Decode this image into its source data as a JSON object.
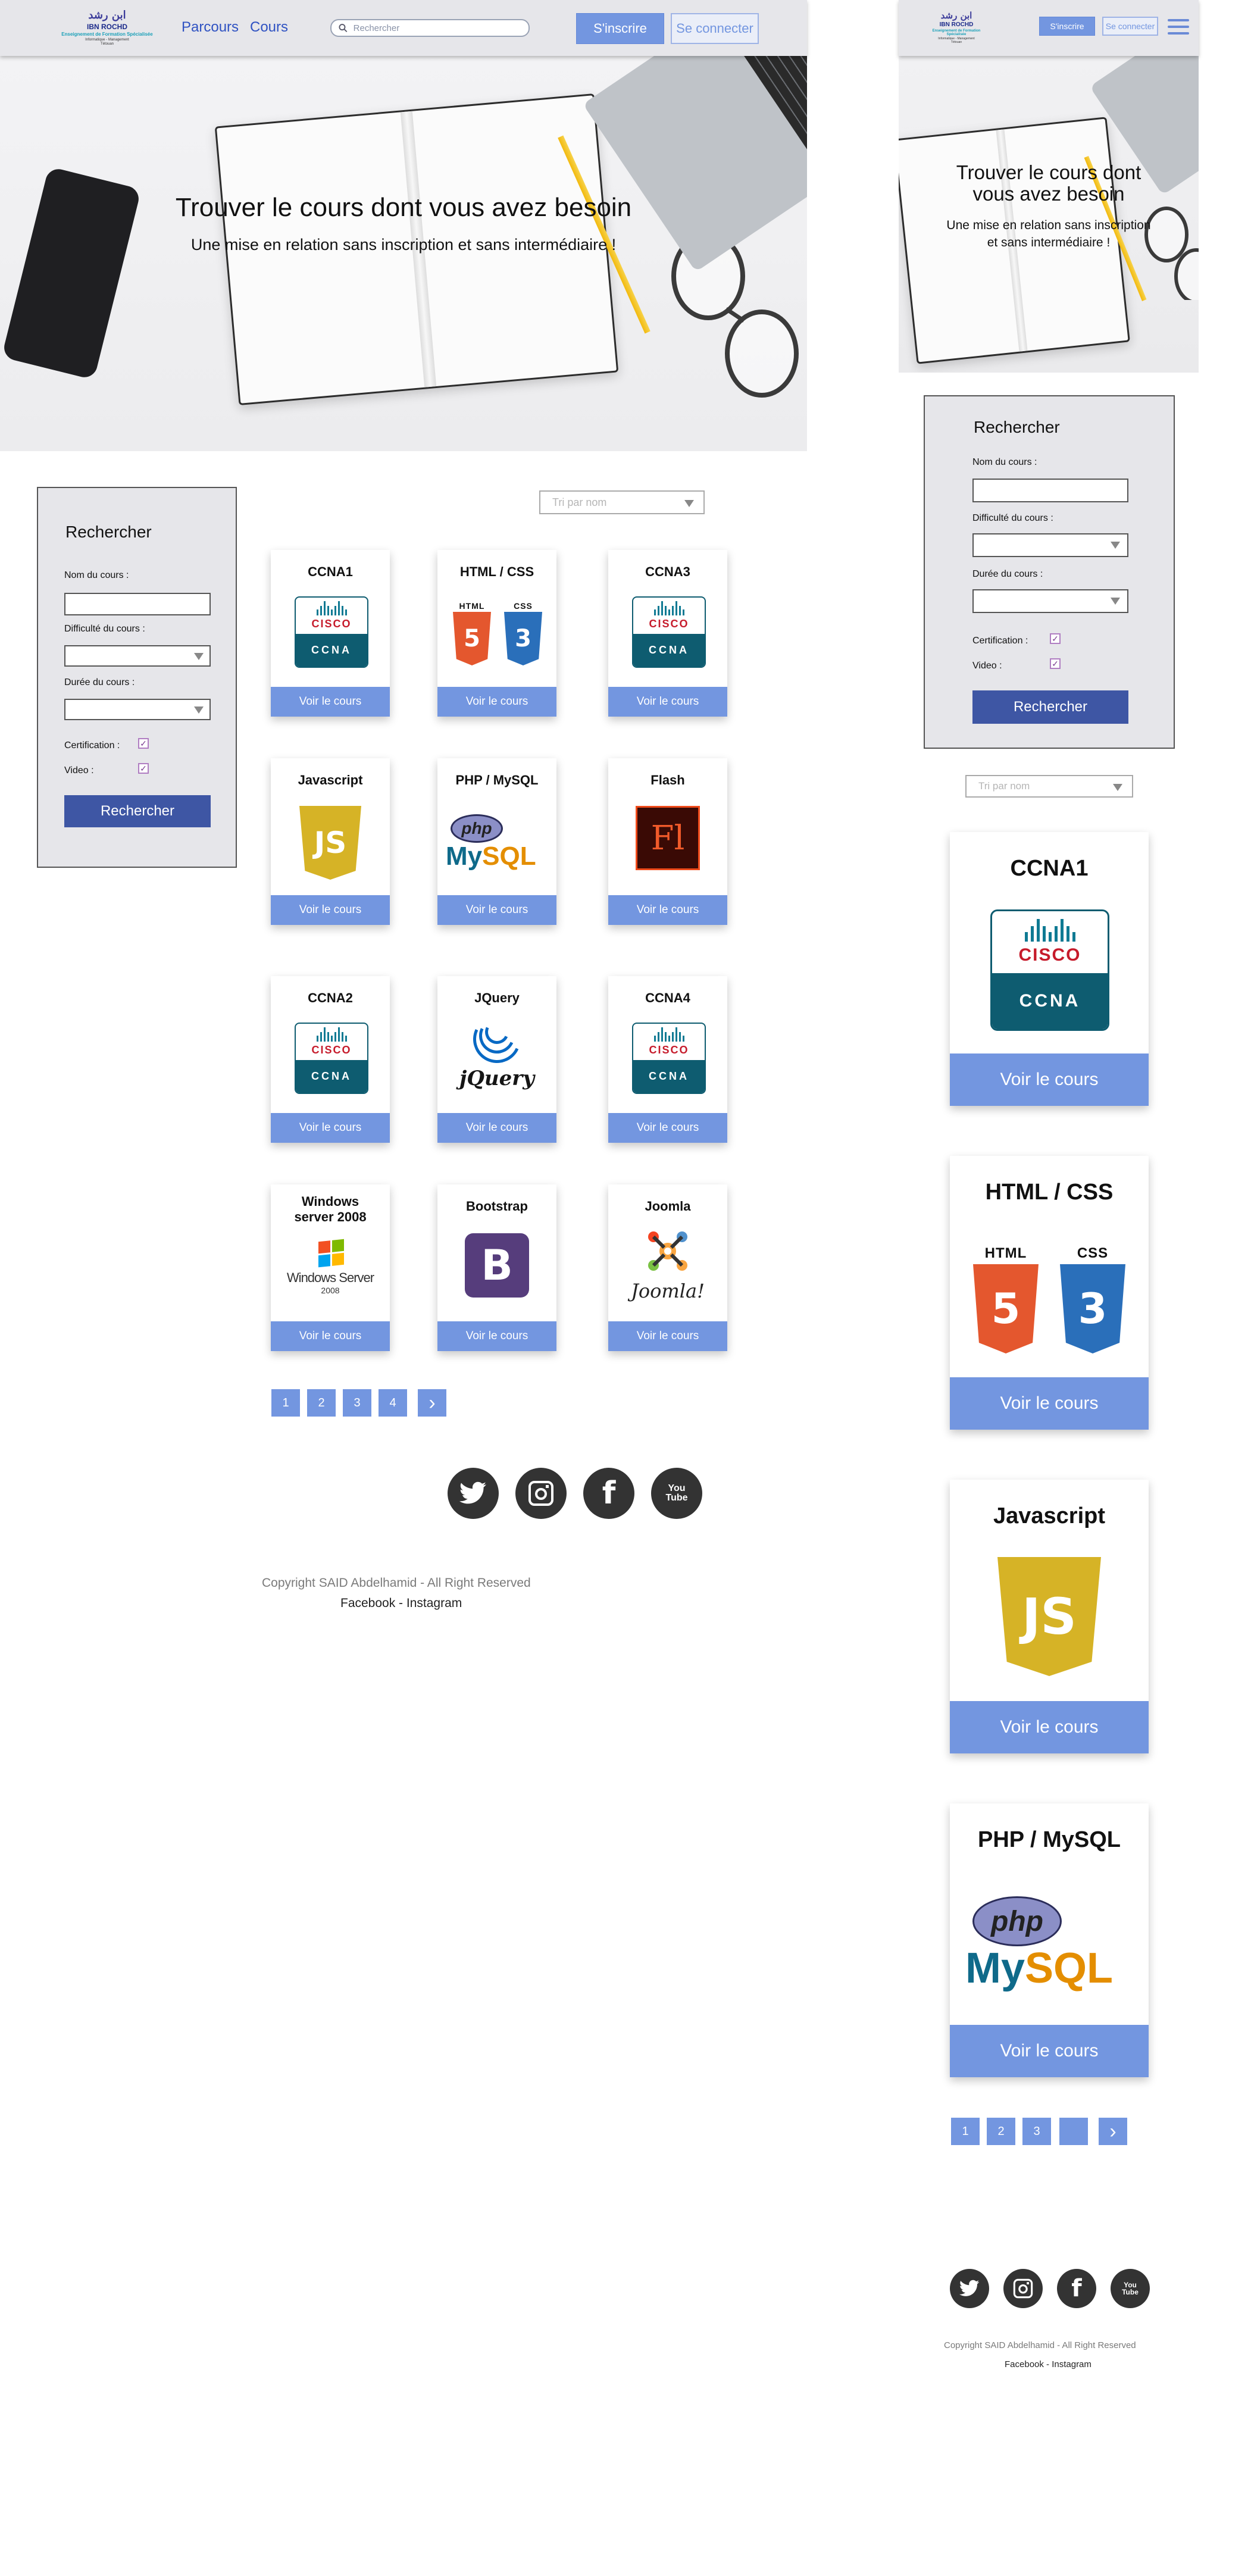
{
  "brand": {
    "arabic": "ابن رشد",
    "line1": "IBN ROCHD",
    "line2": "Enseignement de Formation Spécialisée",
    "line3": "Informatique - Management",
    "line4": "Tétouan"
  },
  "nav": {
    "link1": "Parcours",
    "link2": "Cours"
  },
  "search": {
    "placeholder": "Rechercher"
  },
  "auth": {
    "register": "S'inscrire",
    "login": "Se connecter"
  },
  "hero": {
    "title": "Trouver le cours dont vous avez besoin",
    "subtitle": "Une mise en relation sans inscription et sans intermédiaire !",
    "mobile_title_line1": "Trouver le cours dont",
    "mobile_title_line2": "vous avez besoin",
    "mobile_sub_line1": "Une mise en relation sans inscription",
    "mobile_sub_line2": "et sans intermédiaire !"
  },
  "filter": {
    "title": "Rechercher",
    "name_label": "Nom du cours :",
    "difficulty_label": "Difficulté du cours :",
    "duration_label": "Durée du cours :",
    "certification_label": "Certification :",
    "video_label": "Video :",
    "certification_checked": true,
    "video_checked": true,
    "check_glyph": "✓",
    "submit": "Rechercher"
  },
  "sort": {
    "label": "Tri par nom"
  },
  "courses": [
    {
      "title": "CCNA1",
      "logo": "cisco-ccna-logo"
    },
    {
      "title": "HTML / CSS",
      "logo": "html5-css3-logo"
    },
    {
      "title": "CCNA3",
      "logo": "cisco-ccna-logo"
    },
    {
      "title": "Javascript",
      "logo": "javascript-logo"
    },
    {
      "title": "PHP / MySQL",
      "logo": "php-mysql-logo"
    },
    {
      "title": "Flash",
      "logo": "flash-logo"
    },
    {
      "title": "CCNA2",
      "logo": "cisco-ccna-logo"
    },
    {
      "title": "JQuery",
      "logo": "jquery-logo"
    },
    {
      "title": "CCNA4",
      "logo": "cisco-ccna-logo"
    },
    {
      "title": "Windows server 2008",
      "logo": "windows-server-logo"
    },
    {
      "title": "Bootstrap",
      "logo": "bootstrap-logo"
    },
    {
      "title": "Joomla",
      "logo": "joomla-logo"
    }
  ],
  "windows_title_line1": "Windows",
  "windows_title_line2": "server 2008",
  "card_button": "Voir le cours",
  "logos": {
    "cisco_word": "CISCO",
    "cisco_sub": "CCNA",
    "html_hdr": "HTML",
    "css_hdr": "CSS",
    "html_num": "5",
    "css_num": "3",
    "js": "JS",
    "php": "php",
    "mysql_my": "My",
    "mysql_sql": "SQL",
    "flash": "Fl",
    "jquery": "jQuery",
    "windows_word": "Windows Server",
    "windows_year": "2008",
    "bootstrap": "B",
    "joomla": "Joomla!"
  },
  "pagination": {
    "desktop": [
      "1",
      "2",
      "3",
      "4"
    ],
    "mobile": [
      "1",
      "2",
      "3",
      ""
    ],
    "next": "›"
  },
  "social": [
    {
      "name": "twitter",
      "glyph": "🐦"
    },
    {
      "name": "instagram",
      "glyph": "◎"
    },
    {
      "name": "facebook",
      "glyph": "f"
    },
    {
      "name": "youtube",
      "glyph": "You Tube"
    }
  ],
  "footer": {
    "copyright": "Copyright SAID Abdelhamid - All Right Reserved",
    "links": "Facebook - Instagram"
  },
  "colors": {
    "accent": "#7396e0",
    "dark_button": "#3e56a4",
    "nav_link": "#2f52c2",
    "header_bg": "#e6e6ea"
  }
}
